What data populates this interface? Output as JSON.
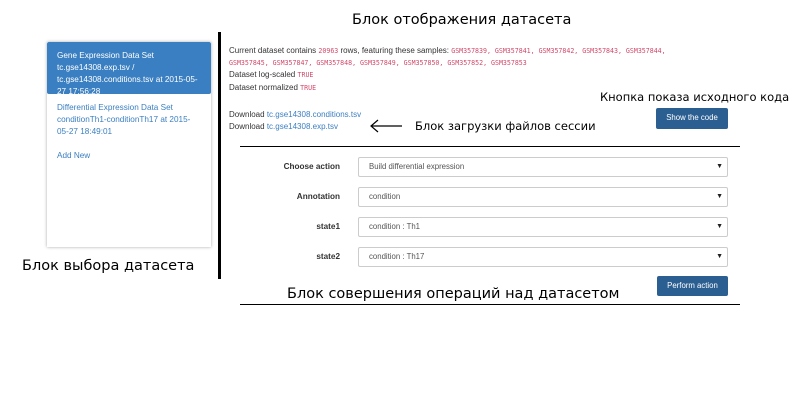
{
  "annotations": {
    "dataset_view": "Блок отображения датасета",
    "show_code": "Кнопка показа исходного кода",
    "download": "Блок загрузки файлов сессии",
    "dataset_select": "Блок выбора датасета",
    "operations": "Блок совершения операций над датасетом"
  },
  "sidebar": {
    "items": [
      {
        "label": "Gene Expression Data Set tc.gse14308.exp.tsv / tc.gse14308.conditions.tsv at 2015-05-27 17:56:28"
      },
      {
        "label": "Differential Expression Data Set conditionTh1-conditionTh17 at 2015-05-27 18:49:01"
      },
      {
        "label": "Add New"
      }
    ]
  },
  "dataset": {
    "prefix": "Current dataset contains",
    "rows": "20963",
    "rows_suffix": "rows, featuring these samples:",
    "samples_line1": "GSM357839, GSM357841, GSM357842, GSM357843, GSM357844,",
    "samples_line2": "GSM357845, GSM357847, GSM357848, GSM357849, GSM357850, GSM357852, GSM357853",
    "log_label": "Dataset log-scaled",
    "log_value": "TRUE",
    "norm_label": "Dataset normalized",
    "norm_value": "TRUE"
  },
  "downloads": {
    "label1": "Download",
    "file1": "tc.gse14308.conditions.tsv",
    "label2": "Download",
    "file2": "tc.gse14308.exp.tsv"
  },
  "buttons": {
    "show_code": "Show the code",
    "perform": "Perform action"
  },
  "form": {
    "action_label": "Choose action",
    "action_value": "Build differential expression",
    "annotation_label": "Annotation",
    "annotation_value": "condition",
    "state1_label": "state1",
    "state1_value": "condition : Th1",
    "state2_label": "state2",
    "state2_value": "condition : Th17"
  },
  "colors": {
    "accent": "#3a7fc1",
    "button": "#2c5f91",
    "code": "#d14a6b"
  }
}
